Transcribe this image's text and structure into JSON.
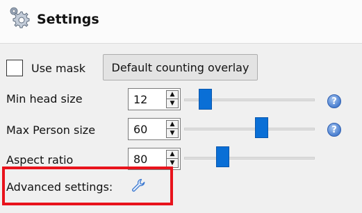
{
  "header": {
    "title": "Settings",
    "icon": "settings-gear-icon"
  },
  "mask": {
    "checkbox_checked": false,
    "label": "Use mask",
    "overlay_button_label": "Default counting overlay"
  },
  "parameters": [
    {
      "label": "Min head size",
      "value": "12",
      "slider_fraction": 0.14,
      "has_help": true
    },
    {
      "label": "Max Person size",
      "value": "60",
      "slider_fraction": 0.58,
      "has_help": true
    },
    {
      "label": "Aspect ratio",
      "value": "80",
      "slider_fraction": 0.29,
      "has_help": false
    }
  ],
  "advanced": {
    "label": "Advanced settings:",
    "icon": "wrench-icon"
  },
  "colors": {
    "slider_thumb": "#0a6fd6",
    "highlight_border": "#e8131c",
    "help_icon": "#4a7fd0"
  }
}
